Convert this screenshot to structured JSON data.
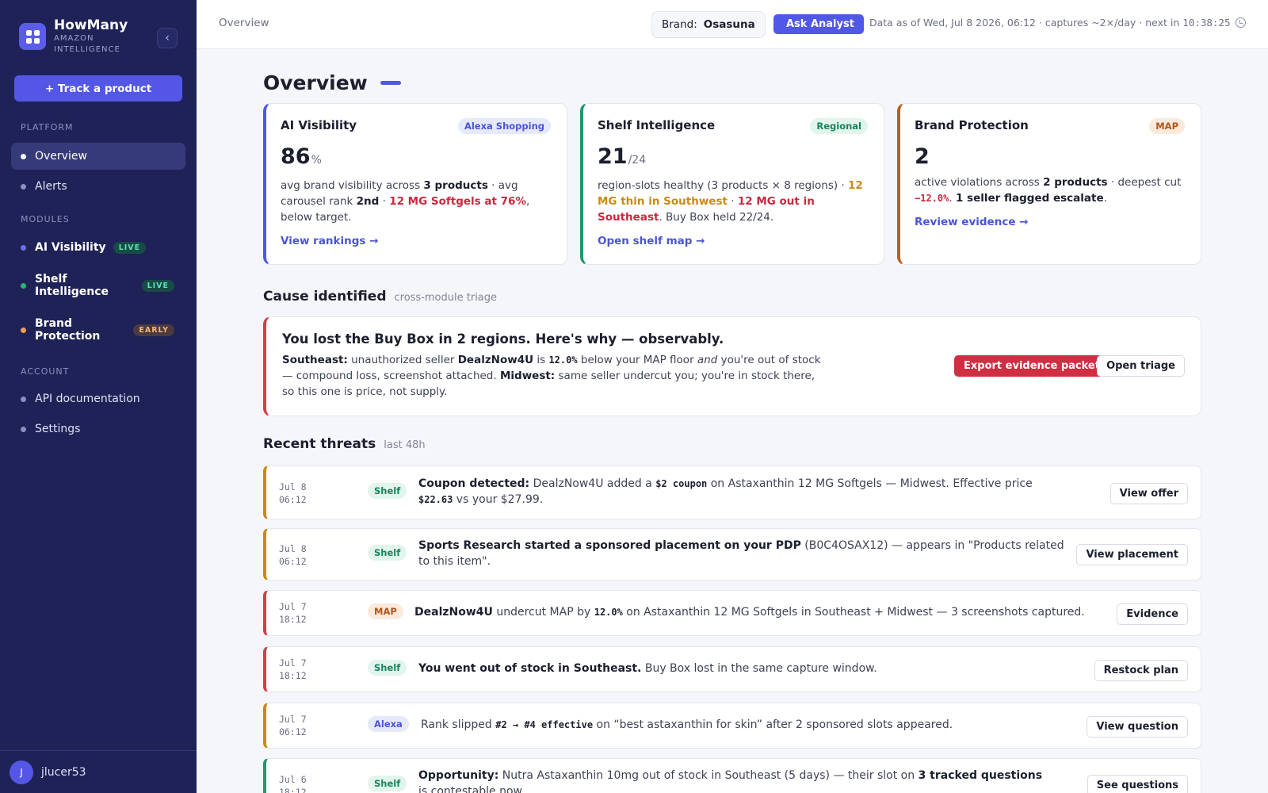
{
  "app": {
    "name": "HowMany",
    "subtitle": "AMAZON INTELLIGENCE"
  },
  "sidebar": {
    "track_button": "+ Track a product",
    "section_platform": "PLATFORM",
    "section_modules": "MODULES",
    "section_account": "ACCOUNT",
    "platform": [
      {
        "label": "Overview",
        "active": true
      },
      {
        "label": "Alerts"
      }
    ],
    "modules": [
      {
        "label": "AI Visibility",
        "badge": "LIVE",
        "color": "#6b6ff0"
      },
      {
        "label": "Shelf Intelligence",
        "badge": "LIVE",
        "color": "#2bb673"
      },
      {
        "label": "Brand Protection",
        "badge": "EARLY",
        "color": "#f0a050"
      }
    ],
    "account": [
      {
        "label": "API documentation"
      },
      {
        "label": "Settings"
      }
    ],
    "user": {
      "initial": "J",
      "name": "jlucer53"
    }
  },
  "topbar": {
    "breadcrumb": "Overview",
    "brand_label": "Brand:",
    "brand_value": "Osasuna",
    "ask_button": "Ask Analyst",
    "data_as_of": "Data as of Wed, Jul 8 2026, 06:12 · captures ~2×/day · next in ",
    "countdown": "10:38:25"
  },
  "overview": {
    "title": "Overview"
  },
  "cards": {
    "ai": {
      "title": "AI Visibility",
      "tag": "Alexa Shopping",
      "value": "86",
      "unit": "%",
      "d1": "avg brand visibility across ",
      "d2": "3 products",
      "d3": " · avg carousel rank ",
      "d4": "2nd",
      "d5": " · ",
      "d6": "12 MG Softgels at 76%",
      "d7": ", below target.",
      "link": "View rankings →"
    },
    "shelf": {
      "title": "Shelf Intelligence",
      "tag": "Regional",
      "value": "21",
      "unit": "/24",
      "d1": "region-slots healthy (3 products × 8 regions) · ",
      "d2": "12 MG thin in Southwest",
      "d3": " · ",
      "d4": "12 MG out in Southeast",
      "d5": ". Buy Box held 22/24.",
      "link": "Open shelf map →"
    },
    "brand": {
      "title": "Brand Protection",
      "tag": "MAP",
      "value": "2",
      "d1": "active violations across ",
      "d2": "2 products",
      "d3": " · deepest cut ",
      "d4": "−12.0%",
      "d5": ". ",
      "d6": "1 seller flagged escalate",
      "d7": ".",
      "link": "Review evidence →"
    }
  },
  "cause": {
    "section_title": "Cause identified",
    "section_sub": "cross-module triage",
    "headline": "You lost the Buy Box in 2 regions. Here's why — observably.",
    "p1": "Southeast:",
    "p2": " unauthorized seller ",
    "p3": "DealzNow4U",
    "p4": " is ",
    "p5": "12.0%",
    "p6": " below your MAP floor ",
    "p7": "and",
    "p8": " you're out of stock — compound loss, screenshot attached. ",
    "p9": "Midwest:",
    "p10": " same seller undercut you; you're in stock there, so this one is price, not supply.",
    "export_button": "Export evidence packet",
    "triage_button": "Open triage"
  },
  "threats": {
    "section_title": "Recent threats",
    "section_sub": "last 48h",
    "items": [
      {
        "d": "Jul 8",
        "t": "06:12",
        "tag": "Shelf",
        "a": "Coupon detected:",
        "b": " DealzNow4U added a ",
        "c": "$2 coupon",
        "e": " on Astaxanthin 12 MG Softgels — Midwest. Effective price ",
        "f": "$22.63",
        "g": " vs your $27.99.",
        "button": "View offer"
      },
      {
        "d": "Jul 8",
        "t": "06:12",
        "tag": "Shelf",
        "a": "Sports Research started a sponsored placement on your PDP",
        "b": " (B0C4OSAX12) — appears in \"Products related to this item\".",
        "button": "View placement"
      },
      {
        "d": "Jul 7",
        "t": "18:12",
        "tag": "MAP",
        "a": "DealzNow4U",
        "b": " undercut MAP by ",
        "c": "12.0%",
        "e": " on Astaxanthin 12 MG Softgels in Southeast + Midwest — 3 screenshots captured.",
        "button": "Evidence"
      },
      {
        "d": "Jul 7",
        "t": "18:12",
        "tag": "Shelf",
        "a": "You went out of stock in Southeast.",
        "b": " Buy Box lost in the same capture window.",
        "button": "Restock plan"
      },
      {
        "d": "Jul 7",
        "t": "06:12",
        "tag": "Alexa",
        "a": "Rank slipped ",
        "c": "#2 → #4 effective",
        "e": " on “best astaxanthin for skin” after 2 sponsored slots appeared.",
        "button": "View question"
      },
      {
        "d": "Jul 6",
        "t": "18:12",
        "tag": "Shelf",
        "a": "Opportunity:",
        "b": " Nutra Astaxanthin 10mg out of stock in Southeast (5 days) — their slot on ",
        "c": "3 tracked questions",
        "e": " is contestable now.",
        "button": "See questions"
      }
    ]
  },
  "colors": {
    "sidebar_bg": "#1f2257",
    "accent": "#5457e6",
    "red": "#cf2f43",
    "amber": "#c98a14",
    "green": "#17845c",
    "ai_border": "#5157e6",
    "shelf_border": "#1f9a6b",
    "brand_border": "#b8601f"
  }
}
